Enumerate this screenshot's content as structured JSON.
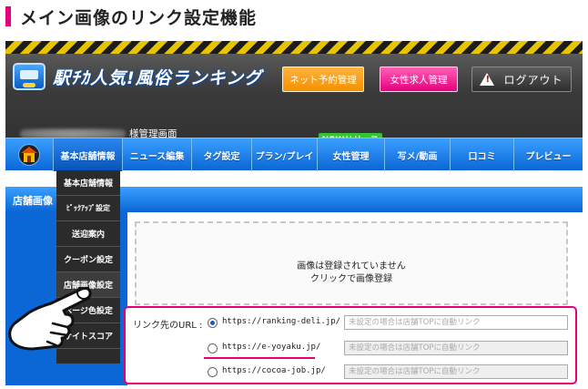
{
  "page_heading": "メイン画像のリンク設定機能",
  "colors": {
    "accent_pink": "#e6007e",
    "nav_blue": "#0b66d6",
    "orange": "#f39100",
    "new_green": "#35c235"
  },
  "header": {
    "logo_text": "駅ﾁｶ人気!風俗ランキング",
    "buttons": {
      "net_reserve": "ネット予約管理",
      "female_job": "女性求人管理",
      "logout": "ログアウト"
    },
    "admin_suffix": "様管理画面"
  },
  "nav": {
    "home_icon": "home-icon",
    "new_badge": "NEWリリース",
    "items": [
      "基本店舗情報",
      "ニュース編集",
      "タグ設定",
      "プラン/プレイ",
      "女性管理",
      "写メ/動画",
      "口コミ",
      "プレビュー"
    ]
  },
  "dropdown": {
    "items": [
      "基本店舗情報",
      "ﾋﾟｯｸｱｯﾌﾟ設定",
      "送迎案内",
      "クーポン設定",
      "店舗画像設定",
      "ページ色設定",
      "サイトスコア"
    ]
  },
  "section": {
    "title": "店舗画像"
  },
  "dropzone": {
    "line1": "画像は登録されていません",
    "line2": "クリックで画像登録"
  },
  "link_settings": {
    "label": "リンク先のURL :",
    "options": [
      {
        "url": "https://ranking-deli.jp/",
        "placeholder": "未設定の場合は店舗TOPに自動リンク",
        "selected": true
      },
      {
        "url": "https://e-yoyaku.jp/",
        "placeholder": "未設定の場合は店舗TOPに自動リンク",
        "selected": false
      },
      {
        "url": "https://cocoa-job.jp/",
        "placeholder": "未設定の場合は店舗TOPに自動リンク",
        "selected": false
      }
    ]
  }
}
